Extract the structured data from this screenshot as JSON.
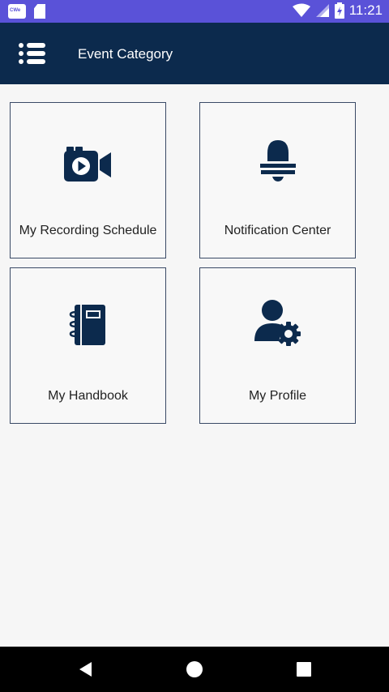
{
  "status_bar": {
    "time": "11:21",
    "app_icon_text": "CWe",
    "icons": [
      "app-notification-icon",
      "sd-card-icon",
      "wifi-icon",
      "cell-signal-icon",
      "battery-icon"
    ]
  },
  "app_bar": {
    "title": "Event Category",
    "menu_icon": "menu-list-icon"
  },
  "tiles": [
    {
      "label": "My Recording Schedule",
      "icon": "video-camera-icon"
    },
    {
      "label": "Notification Center",
      "icon": "bell-icon"
    },
    {
      "label": "My Handbook",
      "icon": "notebook-icon"
    },
    {
      "label": "My Profile",
      "icon": "user-settings-icon"
    }
  ],
  "nav_bar": {
    "icons": [
      "back-icon",
      "home-icon",
      "recents-icon"
    ]
  },
  "colors": {
    "status_bar": "#5a52d8",
    "app_bar": "#0c2a4d",
    "icon": "#0c2a4d",
    "background": "#f6f6f6"
  }
}
